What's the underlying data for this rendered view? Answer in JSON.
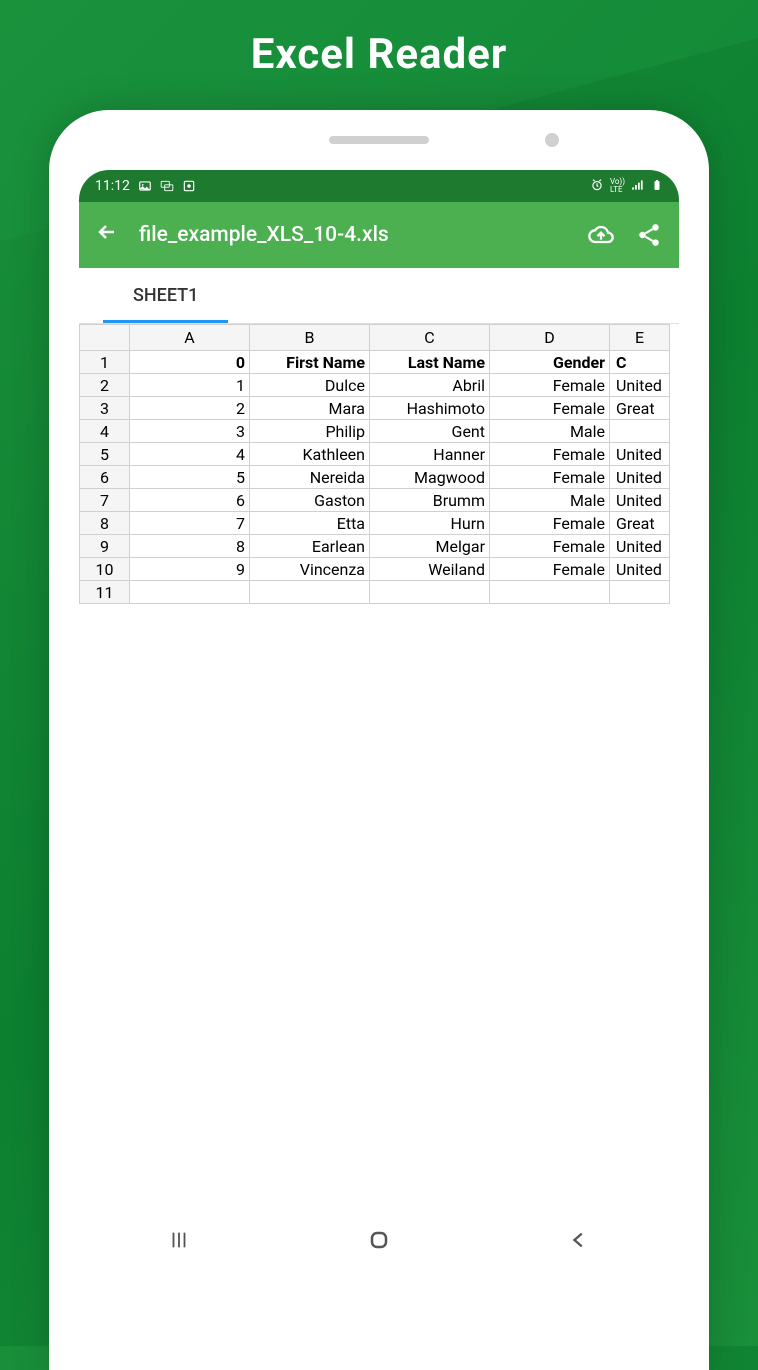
{
  "promo": {
    "title": "Excel  Reader"
  },
  "statusBar": {
    "time": "11:12",
    "rightText": "LTE"
  },
  "appBar": {
    "filename": "file_example_XLS_10-4.xls"
  },
  "tabs": {
    "active": "SHEET1"
  },
  "spreadsheet": {
    "columns": [
      "A",
      "B",
      "C",
      "D",
      "E"
    ],
    "headerRow": {
      "num": "1",
      "cells": [
        "0",
        "First Name",
        "Last Name",
        "Gender",
        "C"
      ]
    },
    "rows": [
      {
        "num": "2",
        "cells": [
          "1",
          "Dulce",
          "Abril",
          "Female",
          "United"
        ]
      },
      {
        "num": "3",
        "cells": [
          "2",
          "Mara",
          "Hashimoto",
          "Female",
          "Great"
        ]
      },
      {
        "num": "4",
        "cells": [
          "3",
          "Philip",
          "Gent",
          "Male",
          ""
        ]
      },
      {
        "num": "5",
        "cells": [
          "4",
          "Kathleen",
          "Hanner",
          "Female",
          "United"
        ]
      },
      {
        "num": "6",
        "cells": [
          "5",
          "Nereida",
          "Magwood",
          "Female",
          "United"
        ]
      },
      {
        "num": "7",
        "cells": [
          "6",
          "Gaston",
          "Brumm",
          "Male",
          "United"
        ]
      },
      {
        "num": "8",
        "cells": [
          "7",
          "Etta",
          "Hurn",
          "Female",
          "Great"
        ]
      },
      {
        "num": "9",
        "cells": [
          "8",
          "Earlean",
          "Melgar",
          "Female",
          "United"
        ]
      },
      {
        "num": "10",
        "cells": [
          "9",
          "Vincenza",
          "Weiland",
          "Female",
          "United"
        ]
      },
      {
        "num": "11",
        "cells": [
          "",
          "",
          "",
          "",
          ""
        ]
      }
    ]
  }
}
